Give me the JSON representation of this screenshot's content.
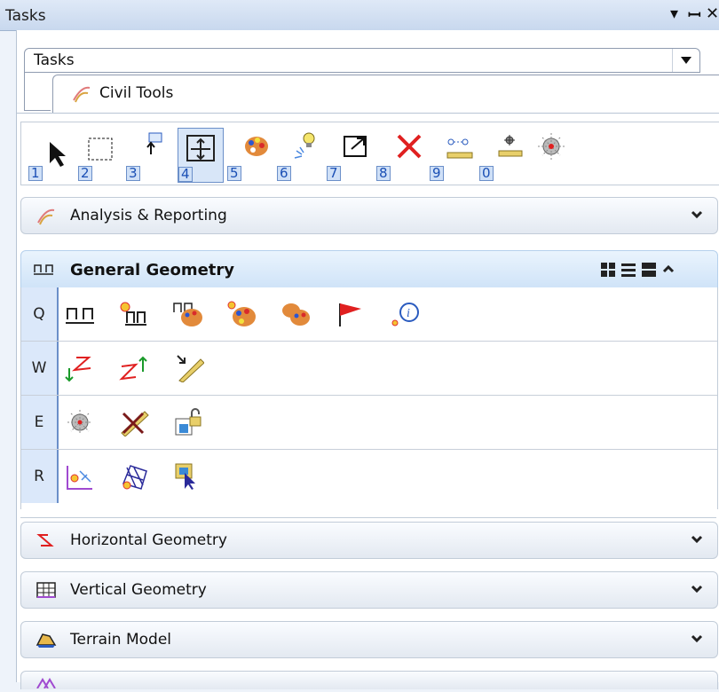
{
  "window": {
    "title": "Tasks"
  },
  "dropdown": {
    "value": "Tasks"
  },
  "tree": {
    "item": "Civil Tools"
  },
  "toolbar": {
    "items": [
      {
        "num": "1",
        "icon": "select-arrow-icon"
      },
      {
        "num": "2",
        "icon": "select-box-icon"
      },
      {
        "num": "3",
        "icon": "insert-icon"
      },
      {
        "num": "4",
        "icon": "fit-view-icon",
        "active": true
      },
      {
        "num": "5",
        "icon": "palette-icon"
      },
      {
        "num": "6",
        "icon": "bulb-icon"
      },
      {
        "num": "7",
        "icon": "export-icon"
      },
      {
        "num": "8",
        "icon": "delete-icon"
      },
      {
        "num": "9",
        "icon": "measure-icon"
      },
      {
        "num": "0",
        "icon": "measure-point-icon"
      },
      {
        "num": "",
        "icon": "target-icon"
      }
    ]
  },
  "sections": {
    "analysis": "Analysis & Reporting",
    "general": "General Geometry",
    "horizontal": "Horizontal Geometry",
    "vertical": "Vertical Geometry",
    "terrain": "Terrain Model"
  },
  "general_rows": [
    {
      "key": "Q"
    },
    {
      "key": "W"
    },
    {
      "key": "E"
    },
    {
      "key": "R"
    }
  ],
  "colors": {
    "accent": "#6b8fc9",
    "delete": "#e02020"
  }
}
